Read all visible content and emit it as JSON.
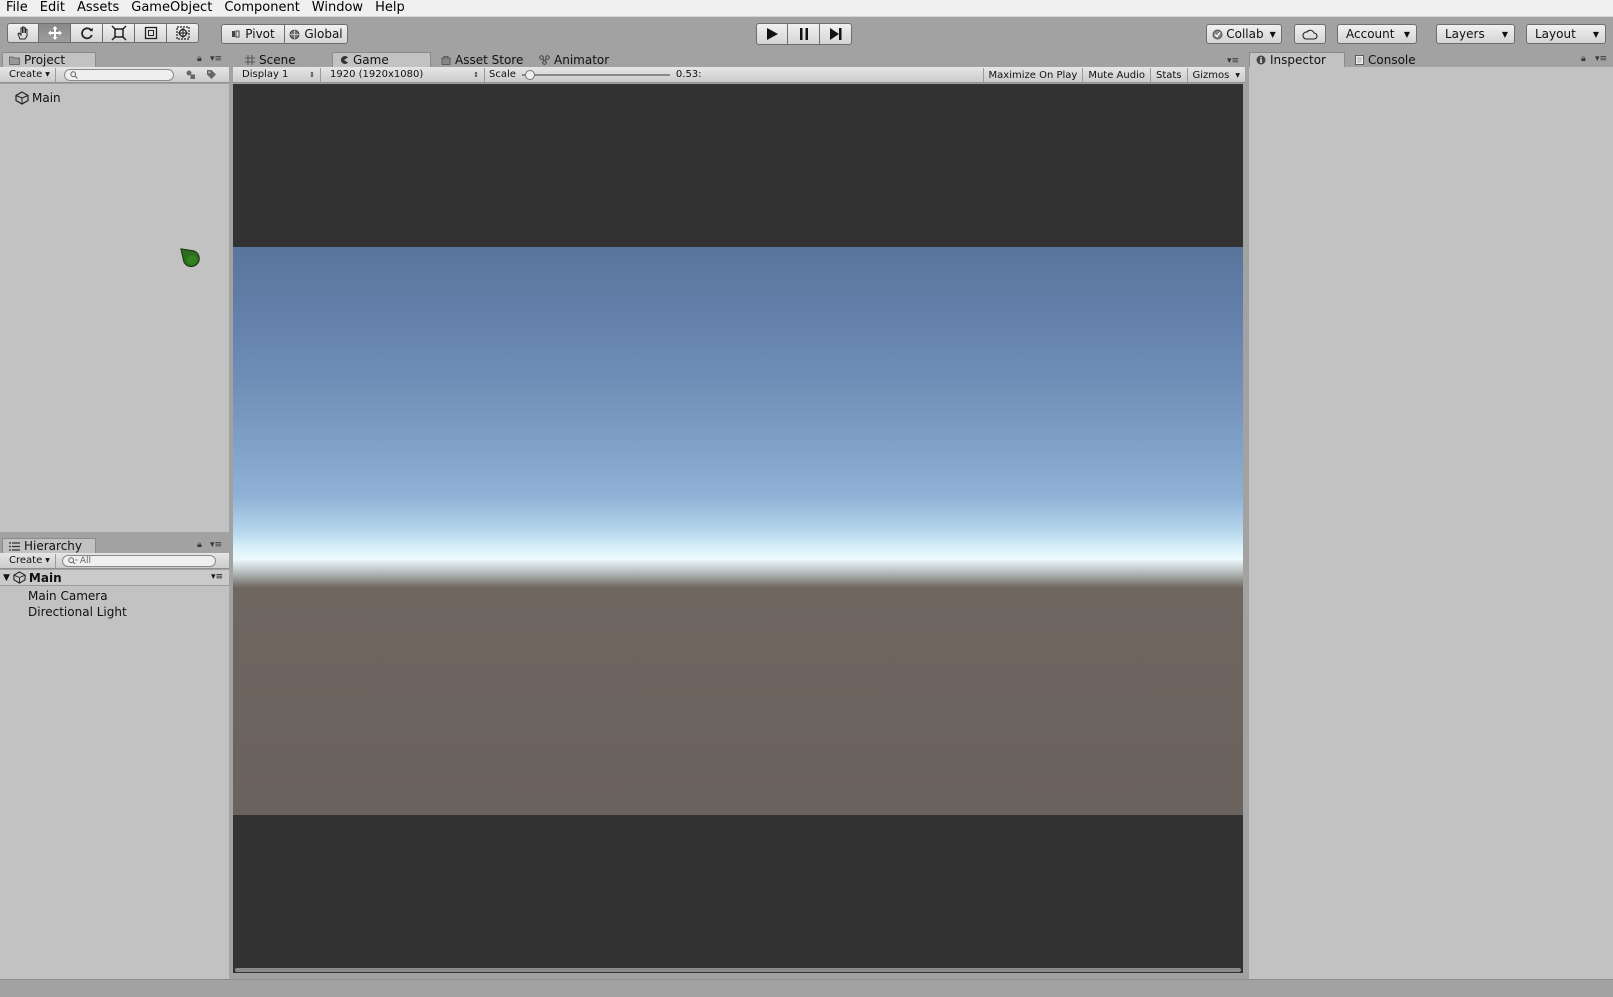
{
  "menu": [
    "File",
    "Edit",
    "Assets",
    "GameObject",
    "Component",
    "Window",
    "Help"
  ],
  "toolbar": {
    "tools": [
      "hand-icon",
      "move-icon",
      "rotate-icon",
      "scale-icon",
      "rect-icon",
      "transform-icon"
    ],
    "pivot": "Pivot",
    "global": "Global",
    "collab": "Collab",
    "account": "Account",
    "layers": "Layers",
    "layout": "Layout"
  },
  "project": {
    "tab": "Project",
    "create": "Create",
    "items": [
      "Main"
    ]
  },
  "hierarchy": {
    "tab": "Hierarchy",
    "create": "Create",
    "search_placeholder": "All",
    "scene": "Main",
    "items": [
      "Main Camera",
      "Directional Light"
    ]
  },
  "center_tabs": [
    "Scene",
    "Game",
    "Asset Store",
    "Animator"
  ],
  "game_toolbar": {
    "display": "Display 1",
    "resolution": "1920 (1920x1080)",
    "scale_label": "Scale",
    "scale_value": "0.53:",
    "scale_fraction": 0.02,
    "maximize": "Maximize On Play",
    "mute": "Mute Audio",
    "stats": "Stats",
    "gizmos": "Gizmos"
  },
  "right_tabs": [
    "Inspector",
    "Console"
  ],
  "colors": {
    "panel": "#c2c2c2",
    "editor_bg": "#a2a2a2",
    "game_letterbox": "#323232",
    "ground": "#6a625d"
  }
}
